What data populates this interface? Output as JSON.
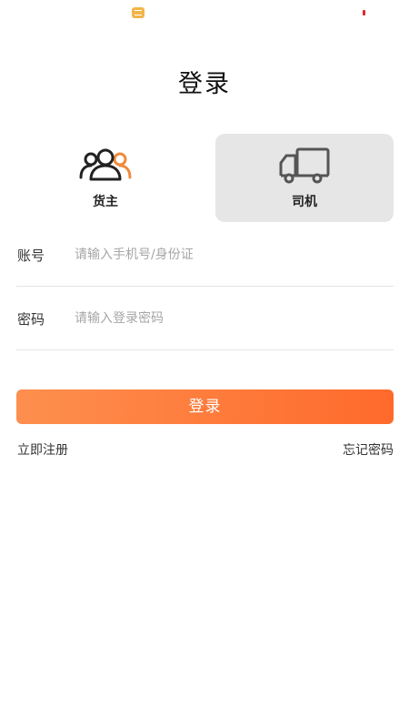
{
  "status_bar": {
    "icons": [
      "message-icon",
      "battery-low-icon"
    ]
  },
  "page": {
    "title": "登录"
  },
  "roles": {
    "selected": "driver",
    "owner": {
      "label": "货主",
      "icon": "users-icon"
    },
    "driver": {
      "label": "司机",
      "icon": "truck-icon"
    }
  },
  "form": {
    "account": {
      "label": "账号",
      "placeholder": "请输入手机号/身份证",
      "value": ""
    },
    "password": {
      "label": "密码",
      "placeholder": "请输入登录密码",
      "value": ""
    }
  },
  "actions": {
    "login_label": "登录",
    "register_label": "立即注册",
    "forgot_label": "忘记密码"
  },
  "colors": {
    "accent_start": "#fd8f4e",
    "accent_end": "#ff6a2b",
    "selected_card_bg": "#e6e6e6"
  }
}
